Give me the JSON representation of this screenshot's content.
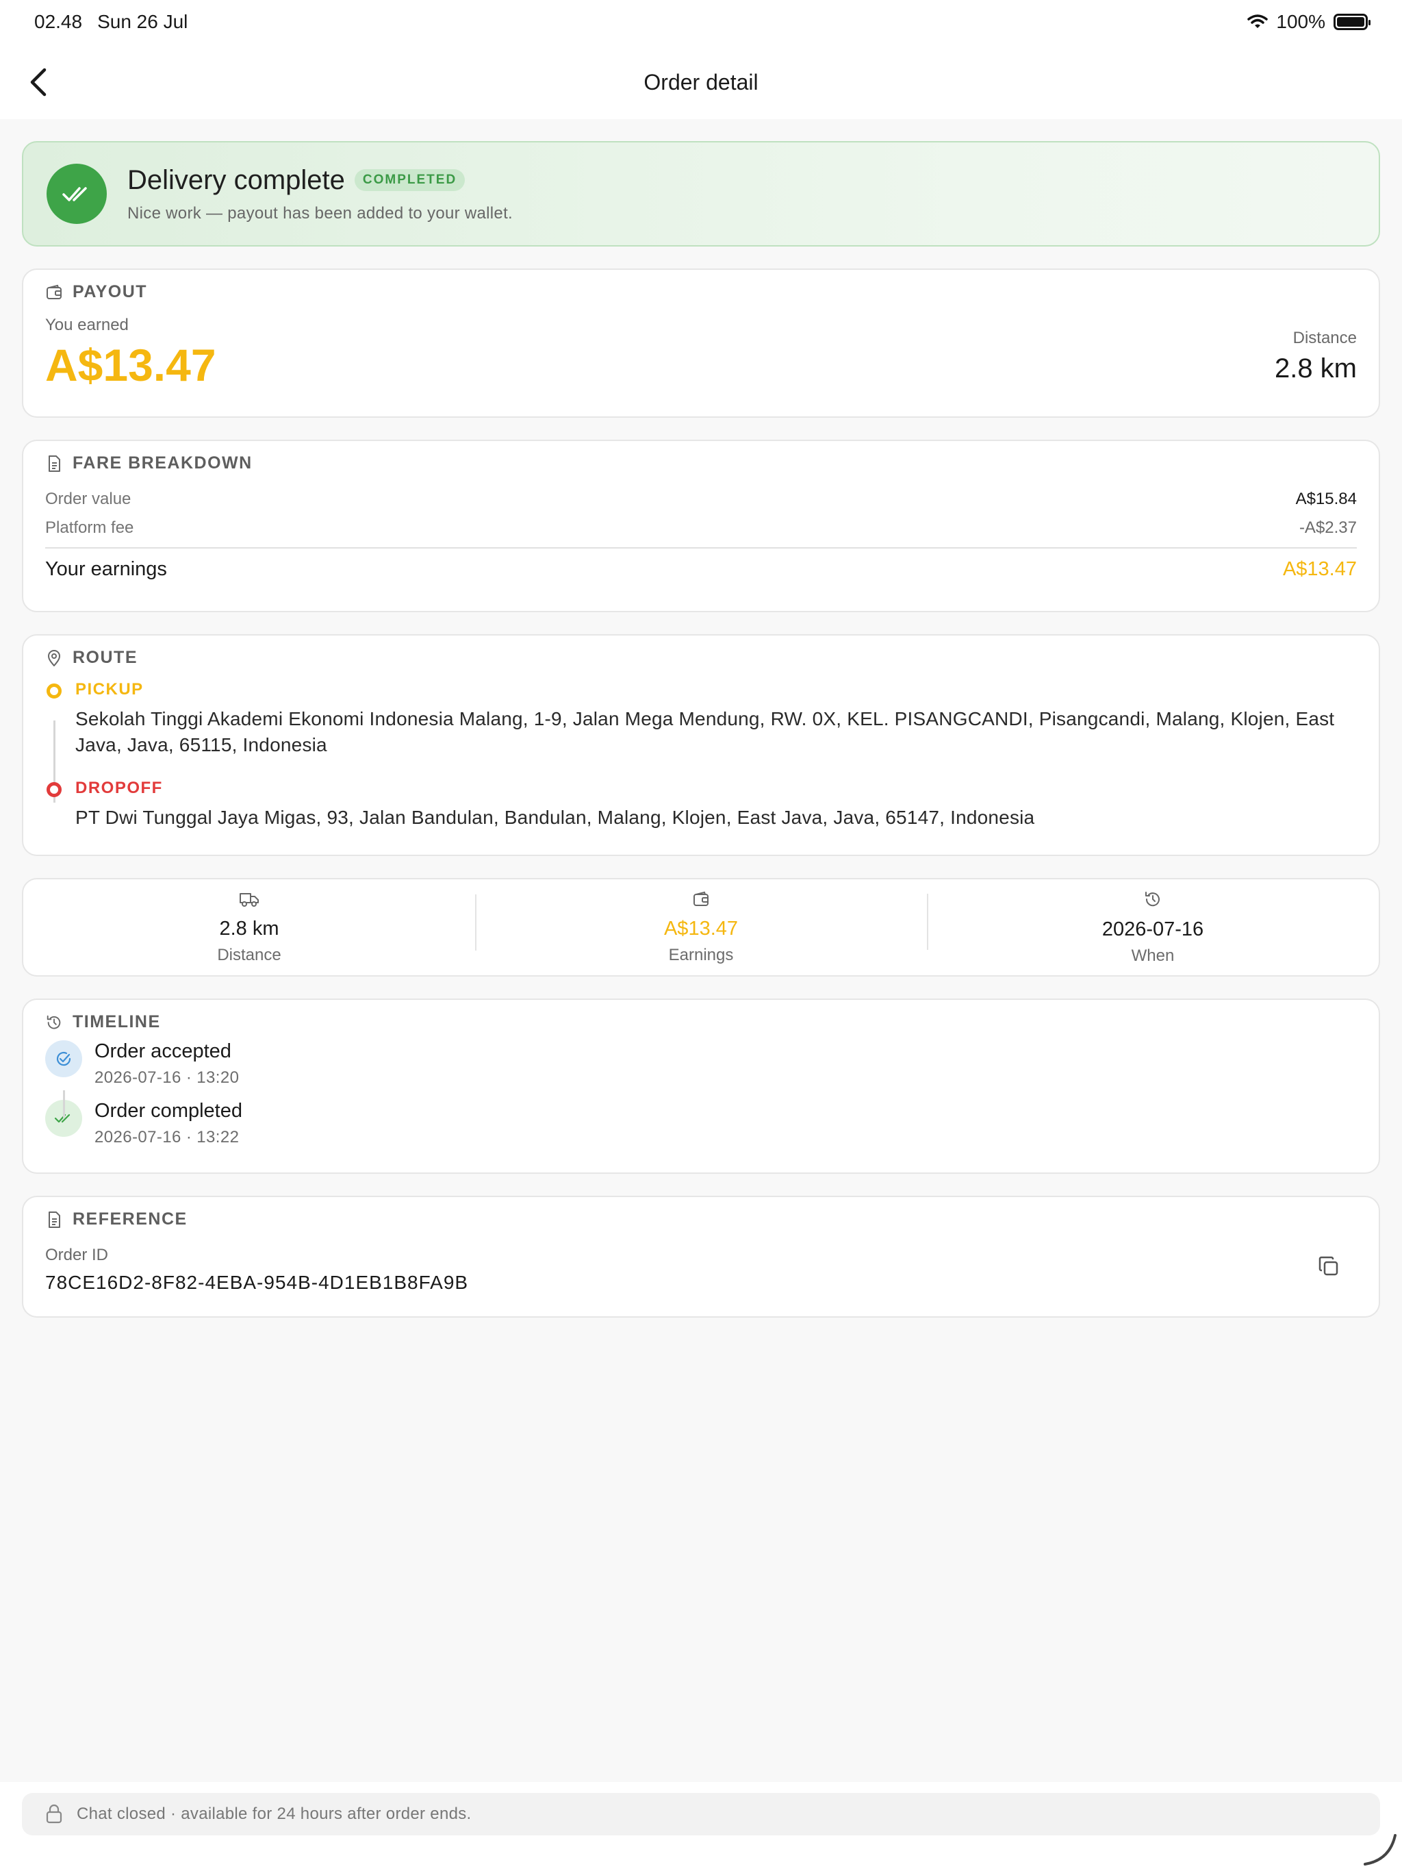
{
  "status_bar": {
    "time": "02.48",
    "date": "Sun 26 Jul",
    "battery": "100%"
  },
  "nav": {
    "title": "Order detail"
  },
  "banner": {
    "title": "Delivery complete",
    "badge": "COMPLETED",
    "subtitle": "Nice work — payout has been added to your wallet."
  },
  "payout": {
    "section": "PAYOUT",
    "earned_label": "You earned",
    "amount": "A$13.47",
    "distance_label": "Distance",
    "distance_value": "2.8 km"
  },
  "fare": {
    "section": "FARE BREAKDOWN",
    "rows": [
      {
        "label": "Order value",
        "value": "A$15.84"
      },
      {
        "label": "Platform fee",
        "value": "-A$2.37"
      }
    ],
    "total_label": "Your earnings",
    "total_value": "A$13.47"
  },
  "route": {
    "section": "ROUTE",
    "pickup": {
      "label": "PICKUP",
      "address": "Sekolah Tinggi Akademi Ekonomi Indonesia Malang, 1-9, Jalan Mega Mendung, RW. 0X, KEL. PISANGCANDI, Pisangcandi, Malang, Klojen, East Java, Java, 65115, Indonesia"
    },
    "dropoff": {
      "label": "DROPOFF",
      "address": "PT Dwi Tunggal Jaya Migas, 93, Jalan Bandulan, Bandulan, Malang, Klojen, East Java, Java, 65147, Indonesia"
    }
  },
  "stats": [
    {
      "value": "2.8 km",
      "label": "Distance"
    },
    {
      "value": "A$13.47",
      "label": "Earnings"
    },
    {
      "value": "2026-07-16",
      "label": "When"
    }
  ],
  "timeline": {
    "section": "TIMELINE",
    "items": [
      {
        "title": "Order accepted",
        "time": "2026-07-16 · 13:20"
      },
      {
        "title": "Order completed",
        "time": "2026-07-16 · 13:22"
      }
    ]
  },
  "reference": {
    "section": "REFERENCE",
    "label": "Order ID",
    "order_id": "78CE16D2-8F82-4EBA-954B-4D1EB1B8FA9B"
  },
  "footer": {
    "chat_notice": "Chat closed · available for 24 hours after order ends."
  },
  "colors": {
    "accent": "#f5b710",
    "success": "#3ea448",
    "pickup": "#f5b710",
    "dropoff": "#e23b3b",
    "info": "#3d8fd6"
  },
  "icons": [
    "chevron-left-icon",
    "wifi-icon",
    "battery-icon",
    "double-check-icon",
    "wallet-icon",
    "document-icon",
    "map-pin-icon",
    "truck-icon",
    "history-icon",
    "copy-icon",
    "lock-icon"
  ]
}
